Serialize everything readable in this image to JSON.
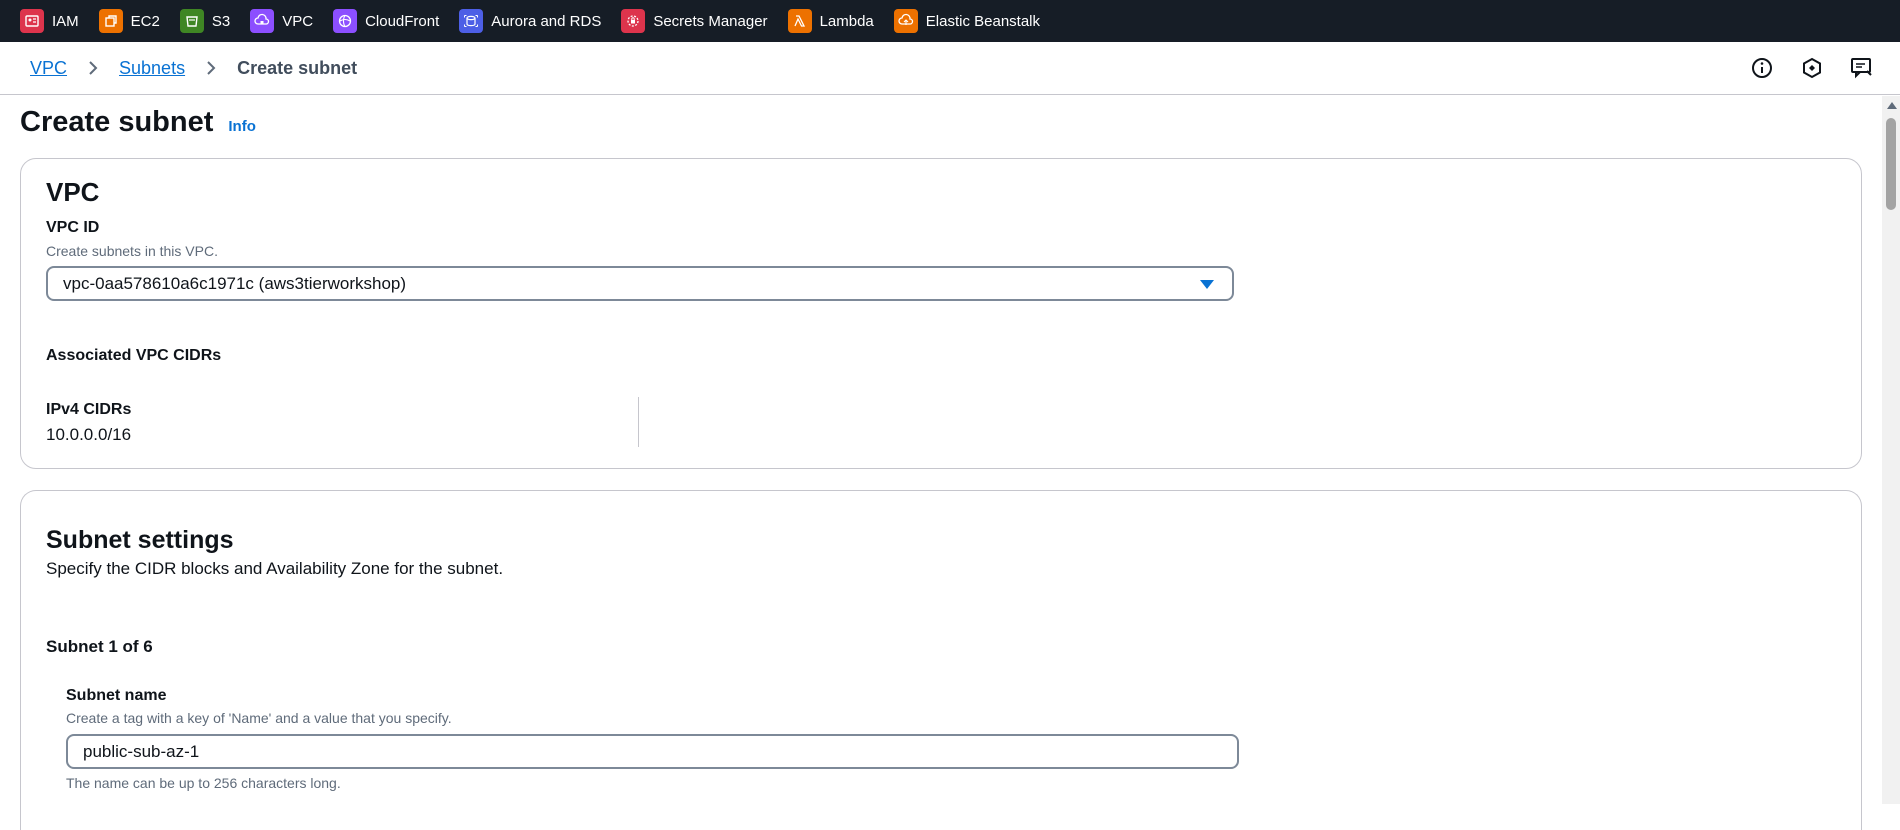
{
  "services": [
    {
      "label": "IAM",
      "icon": "iam-icon",
      "color": "#dd344c"
    },
    {
      "label": "EC2",
      "icon": "ec2-icon",
      "color": "#ed7100"
    },
    {
      "label": "S3",
      "icon": "s3-icon",
      "color": "#3f8624"
    },
    {
      "label": "VPC",
      "icon": "vpc-icon",
      "color": "#8c4fff"
    },
    {
      "label": "CloudFront",
      "icon": "cloudfront-icon",
      "color": "#8c4fff"
    },
    {
      "label": "Aurora and RDS",
      "icon": "rds-icon",
      "color": "#4d5fe6"
    },
    {
      "label": "Secrets Manager",
      "icon": "secrets-manager-icon",
      "color": "#dd344c"
    },
    {
      "label": "Lambda",
      "icon": "lambda-icon",
      "color": "#ed7100"
    },
    {
      "label": "Elastic Beanstalk",
      "icon": "elastic-beanstalk-icon",
      "color": "#ed7100"
    }
  ],
  "breadcrumb": {
    "items": [
      "VPC",
      "Subnets"
    ],
    "current": "Create subnet"
  },
  "page": {
    "title": "Create subnet",
    "info": "Info"
  },
  "vpc_section": {
    "heading": "VPC",
    "vpc_id_label": "VPC ID",
    "vpc_id_desc": "Create subnets in this VPC.",
    "vpc_id_value": "vpc-0aa578610a6c1971c (aws3tierworkshop)",
    "assoc_heading": "Associated VPC CIDRs",
    "ipv4_label": "IPv4 CIDRs",
    "ipv4_value": "10.0.0.0/16"
  },
  "subnet_section": {
    "heading": "Subnet settings",
    "desc": "Specify the CIDR blocks and Availability Zone for the subnet.",
    "counter": "Subnet 1 of 6",
    "name_label": "Subnet name",
    "name_desc": "Create a tag with a key of 'Name' and a value that you specify.",
    "name_value": "public-sub-az-1",
    "name_hint": "The name can be up to 256 characters long."
  },
  "colors": {
    "topbar": "#161d26",
    "link": "#0972d3",
    "border": "#c6c6cd"
  }
}
